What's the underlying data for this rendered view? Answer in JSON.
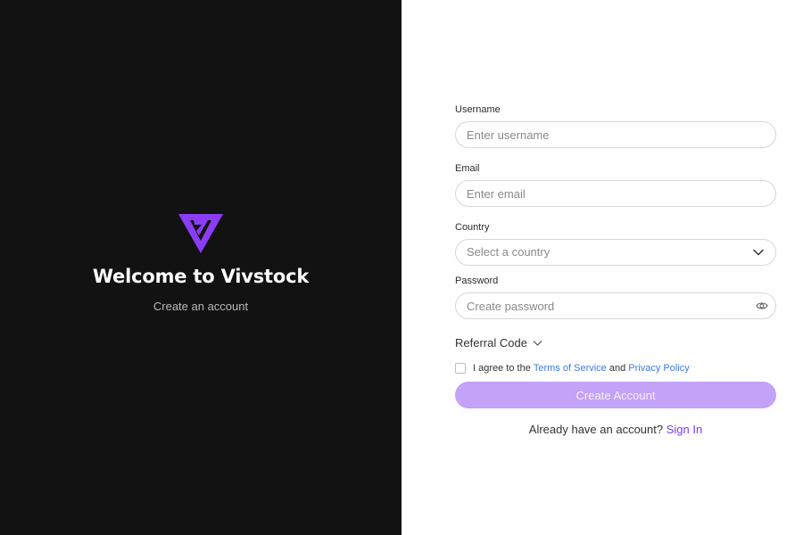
{
  "brand": {
    "title": "Welcome to Vivstock",
    "subtitle": "Create an account",
    "logo_icon": "vivstock-logo-icon",
    "accent_color": "#8b3df5"
  },
  "form": {
    "username": {
      "label": "Username",
      "placeholder": "Enter username",
      "value": ""
    },
    "email": {
      "label": "Email",
      "placeholder": "Enter email",
      "value": ""
    },
    "country": {
      "label": "Country",
      "placeholder": "Select a country",
      "icon": "chevron-down-icon"
    },
    "password": {
      "label": "Password",
      "placeholder": "Create password",
      "value": "",
      "icon": "eye-icon"
    },
    "referral_label": "Referral Code",
    "agree": {
      "prefix": "I agree to the",
      "terms": "Terms of Service",
      "and": "and",
      "privacy": "Privacy Policy",
      "checked": false
    },
    "submit_label": "Create Account",
    "signin_prompt": "Already have an account?",
    "signin_link": "Sign In"
  },
  "colors": {
    "left_bg": "#121212",
    "button_bg": "#c3a2f7",
    "link": "#3f7be0",
    "signin_link": "#7a3df0"
  }
}
